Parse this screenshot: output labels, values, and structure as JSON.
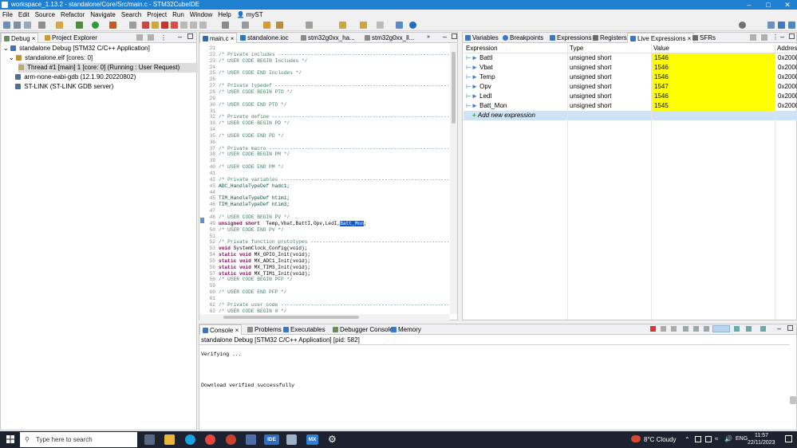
{
  "window": {
    "title": "workspace_1.13.2 - standalone/Core/Src/main.c - STM32CubeIDE"
  },
  "menu": [
    "File",
    "Edit",
    "Source",
    "Refactor",
    "Navigate",
    "Search",
    "Project",
    "Run",
    "Window",
    "Help"
  ],
  "menu_user": "myST",
  "debug_panel": {
    "tabs": [
      "Debug",
      "Project Explorer"
    ],
    "tree": [
      "standalone Debug [STM32 C/C++ Application]",
      "standalone.elf [cores: 0]",
      "Thread #1 [main] 1 [core: 0] (Running : User Request)",
      "arm-none-eabi-gdb (12.1.90.20220802)",
      "ST-LINK (ST-LINK GDB server)"
    ]
  },
  "editor": {
    "tabs": [
      "main.c",
      "standalone.ioc",
      "stm32g0xx_ha...",
      "stm32g0xx_ll..."
    ],
    "lines": [
      {
        "n": "21",
        "t": ""
      },
      {
        "n": "22",
        "t": "/* Private includes ----------------------------------------------------------*/"
      },
      {
        "n": "23",
        "t": "/* USER CODE BEGIN Includes */"
      },
      {
        "n": "24",
        "t": ""
      },
      {
        "n": "25",
        "t": "/* USER CODE END Includes */"
      },
      {
        "n": "26",
        "t": ""
      },
      {
        "n": "27",
        "t": "/* Private typedef -----------------------------------------------------------*/"
      },
      {
        "n": "28",
        "t": "/* USER CODE BEGIN PTD */"
      },
      {
        "n": "29",
        "t": ""
      },
      {
        "n": "30",
        "t": "/* USER CODE END PTD */"
      },
      {
        "n": "31",
        "t": ""
      },
      {
        "n": "32",
        "t": "/* Private define ------------------------------------------------------------*/"
      },
      {
        "n": "33",
        "t": "/* USER CODE BEGIN PD */"
      },
      {
        "n": "34",
        "t": ""
      },
      {
        "n": "35",
        "t": "/* USER CODE END PD */"
      },
      {
        "n": "36",
        "t": ""
      },
      {
        "n": "37",
        "t": "/* Private macro -------------------------------------------------------------*/"
      },
      {
        "n": "38",
        "t": "/* USER CODE BEGIN PM */"
      },
      {
        "n": "39",
        "t": ""
      },
      {
        "n": "40",
        "t": "/* USER CODE END PM */"
      },
      {
        "n": "41",
        "t": ""
      },
      {
        "n": "42",
        "t": "/* Private variables ---------------------------------------------------------*/"
      },
      {
        "n": "43",
        "t": "ADC_HandleTypeDef hadc1;"
      },
      {
        "n": "44",
        "t": ""
      },
      {
        "n": "45",
        "t": "TIM_HandleTypeDef htim1;"
      },
      {
        "n": "46",
        "t": "TIM_HandleTypeDef htim3;"
      },
      {
        "n": "47",
        "t": ""
      },
      {
        "n": "48",
        "t": "/* USER CODE BEGIN PV */"
      },
      {
        "n": "49",
        "t": "unsigned short  Temp,Vbat,BattI,Opv,LedI,"
      },
      {
        "n": "50",
        "t": "/* USER CODE END PV */"
      },
      {
        "n": "51",
        "t": ""
      },
      {
        "n": "52",
        "t": "/* Private function prototypes -----------------------------------------------*/"
      },
      {
        "n": "53",
        "t": "void SystemClock_Config(void);"
      },
      {
        "n": "54",
        "t": "static void MX_GPIO_Init(void);"
      },
      {
        "n": "55",
        "t": "static void MX_ADC1_Init(void);"
      },
      {
        "n": "56",
        "t": "static void MX_TIM3_Init(void);"
      },
      {
        "n": "57",
        "t": "static void MX_TIM1_Init(void);"
      },
      {
        "n": "58",
        "t": "/* USER CODE BEGIN PFP */"
      },
      {
        "n": "59",
        "t": ""
      },
      {
        "n": "60",
        "t": "/* USER CODE END PFP */"
      },
      {
        "n": "61",
        "t": ""
      },
      {
        "n": "62",
        "t": "/* Private user code ---------------------------------------------------------*/"
      },
      {
        "n": "63",
        "t": "/* USER CODE BEGIN 0 */"
      }
    ],
    "selected_text": "Batt_Mon",
    "after_selection": ";"
  },
  "expressions_panel": {
    "tabs": [
      "Variables",
      "Breakpoints",
      "Expressions",
      "Registers",
      "Live Expressions",
      "SFRs"
    ],
    "columns": [
      "Expression",
      "Type",
      "Value",
      "Addres"
    ],
    "rows": [
      {
        "name": "BattI",
        "type": "unsigned short",
        "value": "1546",
        "addr": "0x2000"
      },
      {
        "name": "Vbat",
        "type": "unsigned short",
        "value": "1546",
        "addr": "0x2000"
      },
      {
        "name": "Temp",
        "type": "unsigned short",
        "value": "1546",
        "addr": "0x2000"
      },
      {
        "name": "Opv",
        "type": "unsigned short",
        "value": "1547",
        "addr": "0x2000"
      },
      {
        "name": "LedI",
        "type": "unsigned short",
        "value": "1546",
        "addr": "0x2000"
      },
      {
        "name": "Batt_Mon",
        "type": "unsigned short",
        "value": "1545",
        "addr": "0x2000"
      }
    ],
    "add_label": "Add new expression",
    "highlight_color": "#ffff00"
  },
  "console_panel": {
    "tabs": [
      "Console",
      "Problems",
      "Executables",
      "Debugger Console",
      "Memory"
    ],
    "header": "standalone Debug [STM32 C/C++ Application]  [pid: 582]",
    "lines": [
      "Verifying ...",
      "Download verified successfully"
    ]
  },
  "taskbar": {
    "search_placeholder": "Type here to search",
    "weather": "8°C  Cloudy",
    "time": "11:57",
    "date": "22/11/2023",
    "ide_label": "IDE",
    "mx_label": "MX"
  }
}
